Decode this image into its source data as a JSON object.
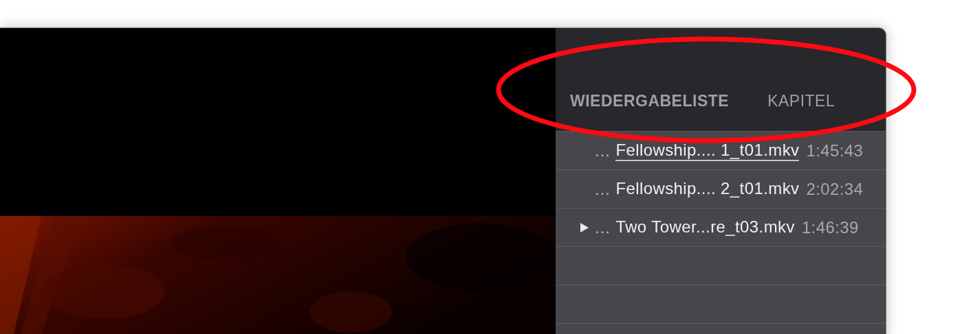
{
  "sidebar": {
    "tabs": [
      {
        "label": "WIEDERGABELISTE",
        "selected": true
      },
      {
        "label": "KAPITEL",
        "selected": false
      }
    ],
    "playlist": [
      {
        "prefix": "…",
        "name": "Fellowship.... 1_t01.mkv",
        "duration": "1:45:43",
        "playing": false,
        "selected": true
      },
      {
        "prefix": "…",
        "name": "Fellowship.... 2_t01.mkv",
        "duration": "2:02:34",
        "playing": false,
        "selected": false
      },
      {
        "prefix": "…",
        "name": "Two Tower...re_t03.mkv",
        "duration": "1:46:39",
        "playing": true,
        "selected": false
      }
    ]
  }
}
